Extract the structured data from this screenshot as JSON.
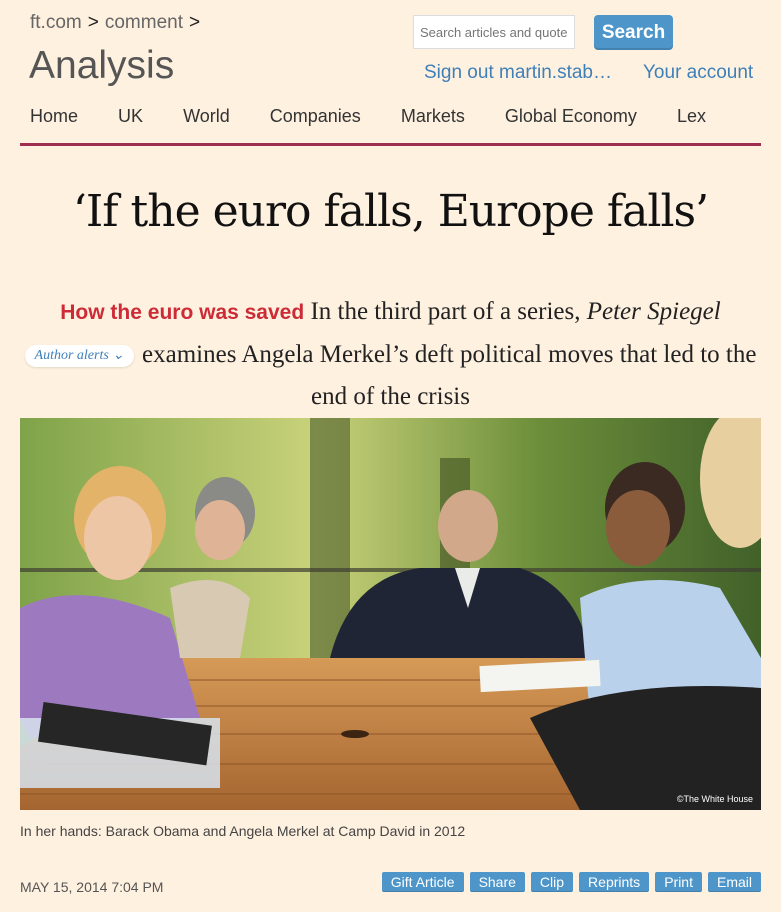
{
  "breadcrumb": {
    "site": "ft.com",
    "separator": ">",
    "section": "comment"
  },
  "section_title": "Analysis",
  "search": {
    "placeholder": "Search articles and quotes",
    "button_label": "Search"
  },
  "account": {
    "sign_out": "Sign out martin.stab…",
    "your_account": "Your account"
  },
  "nav": [
    "Home",
    "UK",
    "World",
    "Companies",
    "Markets",
    "Global Economy",
    "Lex"
  ],
  "article": {
    "headline": "‘If the euro falls, Europe falls’",
    "series_label": "How the euro was saved",
    "standfirst_intro": "In the third part of a series,",
    "author": "Peter Spiegel",
    "author_alerts": "Author alerts",
    "standfirst_rest": "examines Angela Merkel’s deft political moves that led to the end of the crisis",
    "photo_credit": "©The White House",
    "caption": "In her hands: Barack Obama and Angela Merkel at Camp David in 2012",
    "date": "MAY 15, 2014 7:04 PM"
  },
  "tools": [
    "Gift Article",
    "Share",
    "Clip",
    "Reprints",
    "Print",
    "Email"
  ],
  "colors": {
    "background": "#fff1e0",
    "accent_rule": "#9e2f50",
    "link": "#3f7fb8",
    "button": "#4e96c9",
    "series_red": "#cd2b35"
  }
}
